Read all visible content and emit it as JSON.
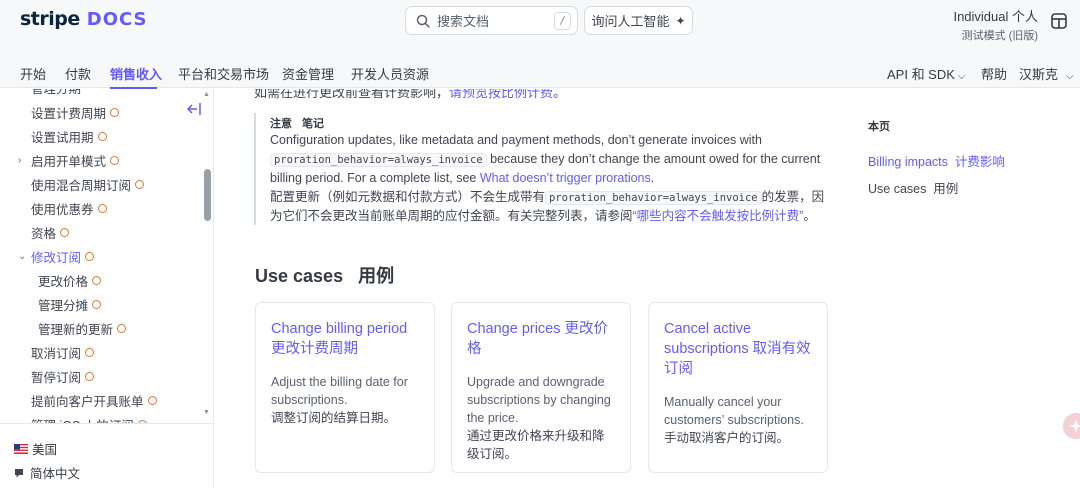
{
  "header": {
    "logo_brand": "stripe",
    "logo_product": "DOCS",
    "search_placeholder": "搜索文档",
    "search_shortcut": "/",
    "ask_ai_label": "询问人工智能",
    "account_name": "Individual  个人",
    "account_mode": "测试模式 (旧版)"
  },
  "nav": {
    "items": [
      "开始",
      "付款",
      "销售收入",
      "平台和交易市场",
      "资金管理",
      "开发人员资源"
    ],
    "active_index": 2,
    "api_sdk": "API 和 SDK",
    "help": "帮助",
    "language": "汉斯克"
  },
  "sidebar": {
    "items": [
      {
        "label": "管理分期",
        "level": 1
      },
      {
        "label": "设置计费周期",
        "level": 1
      },
      {
        "label": "设置试用期",
        "level": 1
      },
      {
        "label": "启用开单模式",
        "level": 1,
        "caret": "right"
      },
      {
        "label": "使用混合周期订阅",
        "level": 1
      },
      {
        "label": "使用优惠券",
        "level": 1
      },
      {
        "label": "资格",
        "level": 1
      },
      {
        "label": "修改订阅",
        "level": 1,
        "caret": "down",
        "active": true
      },
      {
        "label": "更改价格",
        "level": 2
      },
      {
        "label": "管理分摊",
        "level": 2
      },
      {
        "label": "管理新的更新",
        "level": 2
      },
      {
        "label": "取消订阅",
        "level": 1
      },
      {
        "label": "暂停订阅",
        "level": 1
      },
      {
        "label": "提前向客户开具账单",
        "level": 1
      },
      {
        "label": "管理 iOS 上的订阅",
        "level": 1
      }
    ],
    "footer": {
      "country": "美国",
      "language": "简体中文"
    }
  },
  "main": {
    "cut_text": "如需在进行更改前查看计费影响，",
    "cut_link": "请预览按比例计费",
    "cut_end": "。",
    "callout": {
      "tag_note": "注意",
      "tag_notes": "笔记",
      "en_1": "Configuration updates, like metadata and payment methods, don’t generate invoices with",
      "code_1": "proration_behavior=always_invoice",
      "en_2": "because they don’t change the amount owed for the current billing period. For a complete list, see",
      "en_link": "What doesn’t trigger prorations",
      "en_end": ".",
      "zh_1": "配置更新（例如元数据和付款方式）不会生成带有",
      "code_2": "proration_behavior=always_invoice",
      "zh_2": "的发票，因为它们不会更改当前账单周期的应付金额。有关完整列表，请参阅",
      "zh_link": "“哪些内容不会触发按比例计费”",
      "zh_end": "。"
    },
    "use_cases_heading": "Use cases   用例",
    "cards": [
      {
        "title": "Change billing period  更改计费周期",
        "desc_en": "Adjust the billing date for subscriptions.",
        "desc_zh": "调整订阅的结算日期。"
      },
      {
        "title": "Change prices  更改价格",
        "desc_en": "Upgrade and downgrade subscriptions by changing the price.",
        "desc_zh": "通过更改价格来升级和降级订阅。"
      },
      {
        "title": "Cancel active subscriptions 取消有效订阅",
        "desc_en": "Manually cancel your customers’ subscriptions.",
        "desc_zh": "手动取消客户的订阅。"
      }
    ]
  },
  "toc": {
    "header": "本页",
    "items": [
      "Billing impacts  计费影响",
      "Use cases  用例"
    ],
    "active_index": 0
  },
  "colors": {
    "accent": "#635bff",
    "ring": "#e0782f",
    "heading": "#353a44"
  }
}
